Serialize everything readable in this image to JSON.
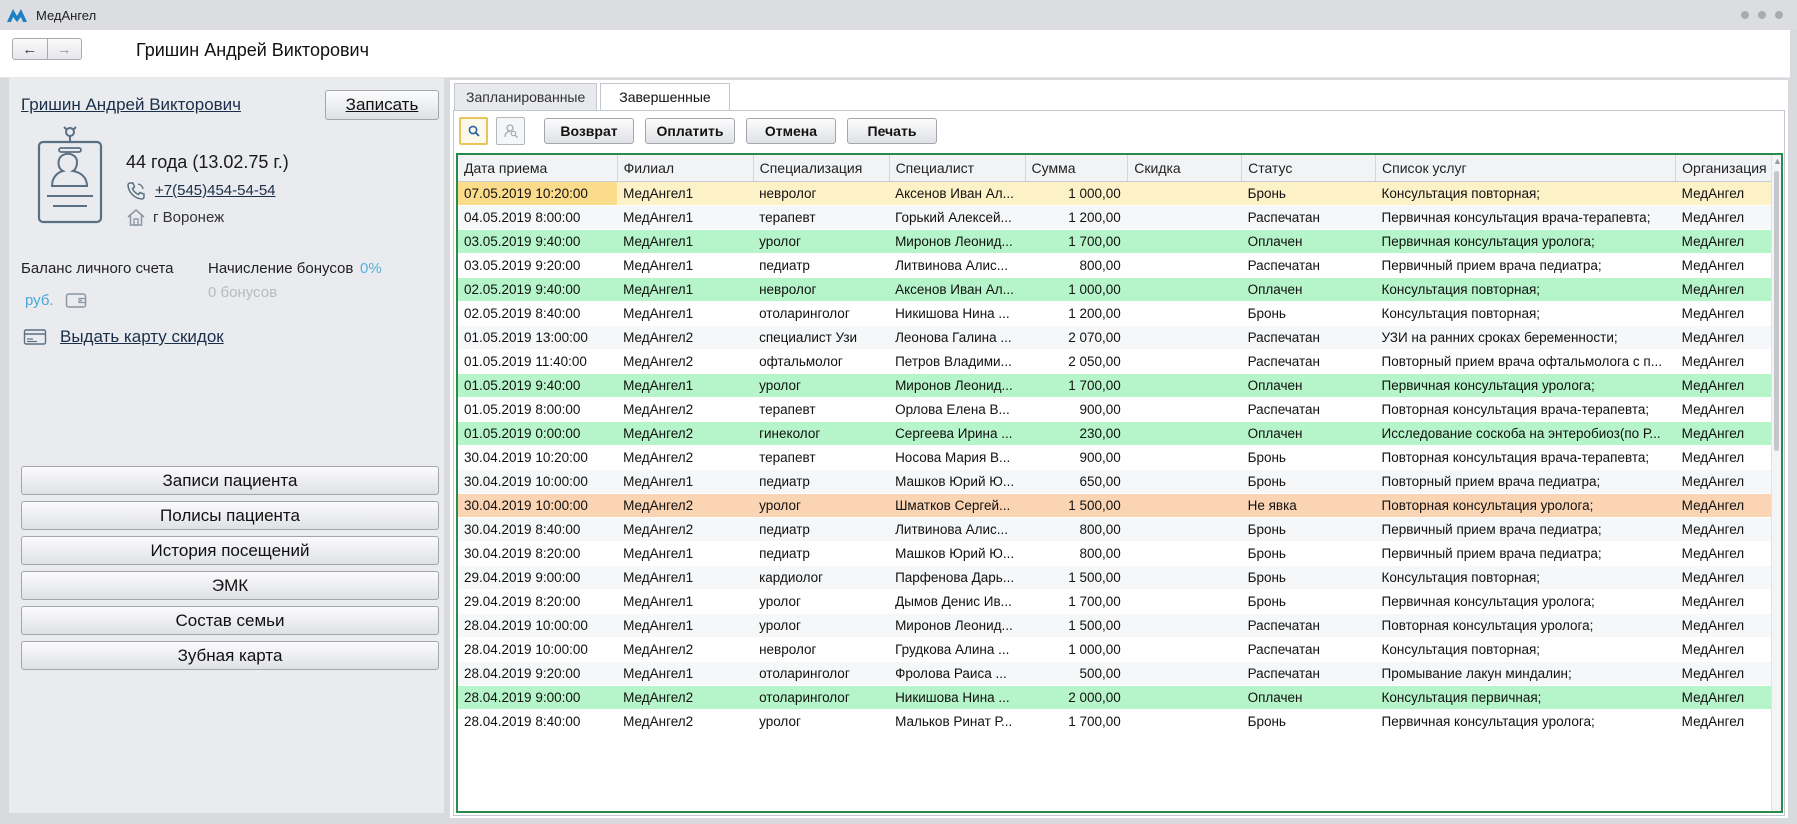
{
  "app": {
    "name": "МедАнгел"
  },
  "header": {
    "patient_title": "Гришин Андрей Викторович"
  },
  "patient": {
    "name": "Гришин Андрей Викторович",
    "record_button": "Записать",
    "age": "44 года  (13.02.75 г.)",
    "phone": "+7(545)454-54-54",
    "city": "г Воронеж",
    "balance_label": "Баланс личного счета",
    "balance_currency": "руб.",
    "bonus_label": "Начисление бонусов",
    "bonus_percent": "0%",
    "bonus_count": "0 бонусов",
    "discount_card_link": "Выдать карту скидок"
  },
  "menu": [
    {
      "label": "Записи пациента"
    },
    {
      "label": "Полисы пациента"
    },
    {
      "label": "История посещений"
    },
    {
      "label": "ЭМК"
    },
    {
      "label": "Состав семьи"
    },
    {
      "label": "Зубная карта"
    }
  ],
  "tabs": [
    {
      "label": "Запланированные",
      "active": false
    },
    {
      "label": "Завершенные",
      "active": true
    }
  ],
  "toolbar": {
    "search_icon": "search-icon",
    "user_search_icon": "user-search-icon",
    "buttons": [
      "Возврат",
      "Оплатить",
      "Отмена",
      "Печать"
    ]
  },
  "colors": {
    "paid_row": "#b6f5c9",
    "no_show_row": "#fbd5b3",
    "selected_row": "#fdf1c7",
    "grid_border": "#2a8a4a",
    "link": "#1b2f4a"
  },
  "table": {
    "columns": [
      "Дата приема",
      "Филиал",
      "Специализация",
      "Специалист",
      "Сумма",
      "Скидка",
      "Статус",
      "Список услуг",
      "Организация"
    ],
    "rows": [
      {
        "date": "07.05.2019 10:20:00",
        "branch": "МедАнгел1",
        "spec": "невролог",
        "doctor": "Аксенов Иван Ал...",
        "sum": "1 000,00",
        "discount": "",
        "status": "Бронь",
        "services": "Консультация повторная;",
        "org": "МедАнгел",
        "state": "selected"
      },
      {
        "date": "04.05.2019 8:00:00",
        "branch": "МедАнгел1",
        "spec": "терапевт",
        "doctor": "Горький Алексей...",
        "sum": "1 200,00",
        "discount": "",
        "status": "Распечатан",
        "services": "Первичная консультация врача-терапевта;",
        "org": "МедАнгел",
        "state": "gray"
      },
      {
        "date": "03.05.2019 9:40:00",
        "branch": "МедАнгел1",
        "spec": "уролог",
        "doctor": "Миронов Леонид...",
        "sum": "1 700,00",
        "discount": "",
        "status": "Оплачен",
        "services": "Первичная консультация уролога;",
        "org": "МедАнгел",
        "state": "green"
      },
      {
        "date": "03.05.2019 9:20:00",
        "branch": "МедАнгел1",
        "spec": "педиатр",
        "doctor": "Литвинова Алис...",
        "sum": "800,00",
        "discount": "",
        "status": "Распечатан",
        "services": "Первичный прием врача педиатра;",
        "org": "МедАнгел",
        "state": "white"
      },
      {
        "date": "02.05.2019 9:40:00",
        "branch": "МедАнгел1",
        "spec": "невролог",
        "doctor": "Аксенов Иван Ал...",
        "sum": "1 000,00",
        "discount": "",
        "status": "Оплачен",
        "services": "Консультация повторная;",
        "org": "МедАнгел",
        "state": "green"
      },
      {
        "date": "02.05.2019 8:40:00",
        "branch": "МедАнгел1",
        "spec": "отоларинголог",
        "doctor": "Никишова Нина ...",
        "sum": "1 200,00",
        "discount": "",
        "status": "Бронь",
        "services": "Консультация повторная;",
        "org": "МедАнгел",
        "state": "white"
      },
      {
        "date": "01.05.2019 13:00:00",
        "branch": "МедАнгел2",
        "spec": "специалист Узи",
        "doctor": "Леонова Галина ...",
        "sum": "2 070,00",
        "discount": "",
        "status": "Распечатан",
        "services": "УЗИ на ранних сроках беременности;",
        "org": "МедАнгел",
        "state": "gray"
      },
      {
        "date": "01.05.2019 11:40:00",
        "branch": "МедАнгел2",
        "spec": "офтальмолог",
        "doctor": "Петров Владими...",
        "sum": "2 050,00",
        "discount": "",
        "status": "Распечатан",
        "services": "Повторный прием врача офтальмолога с п...",
        "org": "МедАнгел",
        "state": "white"
      },
      {
        "date": "01.05.2019 9:40:00",
        "branch": "МедАнгел1",
        "spec": "уролог",
        "doctor": "Миронов Леонид...",
        "sum": "1 700,00",
        "discount": "",
        "status": "Оплачен",
        "services": "Первичная консультация уролога;",
        "org": "МедАнгел",
        "state": "green"
      },
      {
        "date": "01.05.2019 8:00:00",
        "branch": "МедАнгел2",
        "spec": "терапевт",
        "doctor": "Орлова Елена В...",
        "sum": "900,00",
        "discount": "",
        "status": "Распечатан",
        "services": "Повторная консультация врача-терапевта;",
        "org": "МедАнгел",
        "state": "white"
      },
      {
        "date": "01.05.2019 0:00:00",
        "branch": "МедАнгел2",
        "spec": "гинеколог",
        "doctor": "Сергеева Ирина ...",
        "sum": "230,00",
        "discount": "",
        "status": "Оплачен",
        "services": "Исследование соскоба на энтеробиоз(по Р...",
        "org": "МедАнгел",
        "state": "green"
      },
      {
        "date": "30.04.2019 10:20:00",
        "branch": "МедАнгел2",
        "spec": "терапевт",
        "doctor": "Носова Мария В...",
        "sum": "900,00",
        "discount": "",
        "status": "Бронь",
        "services": "Повторная консультация врача-терапевта;",
        "org": "МедАнгел",
        "state": "white"
      },
      {
        "date": "30.04.2019 10:00:00",
        "branch": "МедАнгел1",
        "spec": "педиатр",
        "doctor": "Машков Юрий Ю...",
        "sum": "650,00",
        "discount": "",
        "status": "Бронь",
        "services": "Повторный прием врача педиатра;",
        "org": "МедАнгел",
        "state": "gray"
      },
      {
        "date": "30.04.2019 10:00:00",
        "branch": "МедАнгел2",
        "spec": "уролог",
        "doctor": "Шматков Сергей...",
        "sum": "1 500,00",
        "discount": "",
        "status": "Не явка",
        "services": "Повторная консультация уролога;",
        "org": "МедАнгел",
        "state": "orange"
      },
      {
        "date": "30.04.2019 8:40:00",
        "branch": "МедАнгел2",
        "spec": "педиатр",
        "doctor": "Литвинова Алис...",
        "sum": "800,00",
        "discount": "",
        "status": "Бронь",
        "services": "Первичный прием врача педиатра;",
        "org": "МедАнгел",
        "state": "gray"
      },
      {
        "date": "30.04.2019 8:20:00",
        "branch": "МедАнгел1",
        "spec": "педиатр",
        "doctor": "Машков Юрий Ю...",
        "sum": "800,00",
        "discount": "",
        "status": "Бронь",
        "services": "Первичный прием врача педиатра;",
        "org": "МедАнгел",
        "state": "white"
      },
      {
        "date": "29.04.2019 9:00:00",
        "branch": "МедАнгел1",
        "spec": "кардиолог",
        "doctor": "Парфенова Дарь...",
        "sum": "1 500,00",
        "discount": "",
        "status": "Бронь",
        "services": "Консультация повторная;",
        "org": "МедАнгел",
        "state": "gray"
      },
      {
        "date": "29.04.2019 8:20:00",
        "branch": "МедАнгел1",
        "spec": "уролог",
        "doctor": "Дымов Денис Ив...",
        "sum": "1 700,00",
        "discount": "",
        "status": "Бронь",
        "services": "Первичная консультация уролога;",
        "org": "МедАнгел",
        "state": "white"
      },
      {
        "date": "28.04.2019 10:00:00",
        "branch": "МедАнгел1",
        "spec": "уролог",
        "doctor": "Миронов Леонид...",
        "sum": "1 500,00",
        "discount": "",
        "status": "Распечатан",
        "services": "Повторная консультация уролога;",
        "org": "МедАнгел",
        "state": "gray"
      },
      {
        "date": "28.04.2019 10:00:00",
        "branch": "МедАнгел2",
        "spec": "невролог",
        "doctor": "Грудкова Алина ...",
        "sum": "1 000,00",
        "discount": "",
        "status": "Распечатан",
        "services": "Консультация повторная;",
        "org": "МедАнгел",
        "state": "white"
      },
      {
        "date": "28.04.2019 9:20:00",
        "branch": "МедАнгел1",
        "spec": "отоларинголог",
        "doctor": "Фролова Раиса ...",
        "sum": "500,00",
        "discount": "",
        "status": "Распечатан",
        "services": "Промывание лакун миндалин;",
        "org": "МедАнгел",
        "state": "gray"
      },
      {
        "date": "28.04.2019 9:00:00",
        "branch": "МедАнгел2",
        "spec": "отоларинголог",
        "doctor": "Никишова Нина ...",
        "sum": "2 000,00",
        "discount": "",
        "status": "Оплачен",
        "services": "Консультация первичная;",
        "org": "МедАнгел",
        "state": "green"
      },
      {
        "date": "28.04.2019 8:40:00",
        "branch": "МедАнгел2",
        "spec": "уролог",
        "doctor": "Мальков Ринат Р...",
        "sum": "1 700,00",
        "discount": "",
        "status": "Бронь",
        "services": "Первичная консультация уролога;",
        "org": "МедАнгел",
        "state": "white"
      }
    ]
  }
}
